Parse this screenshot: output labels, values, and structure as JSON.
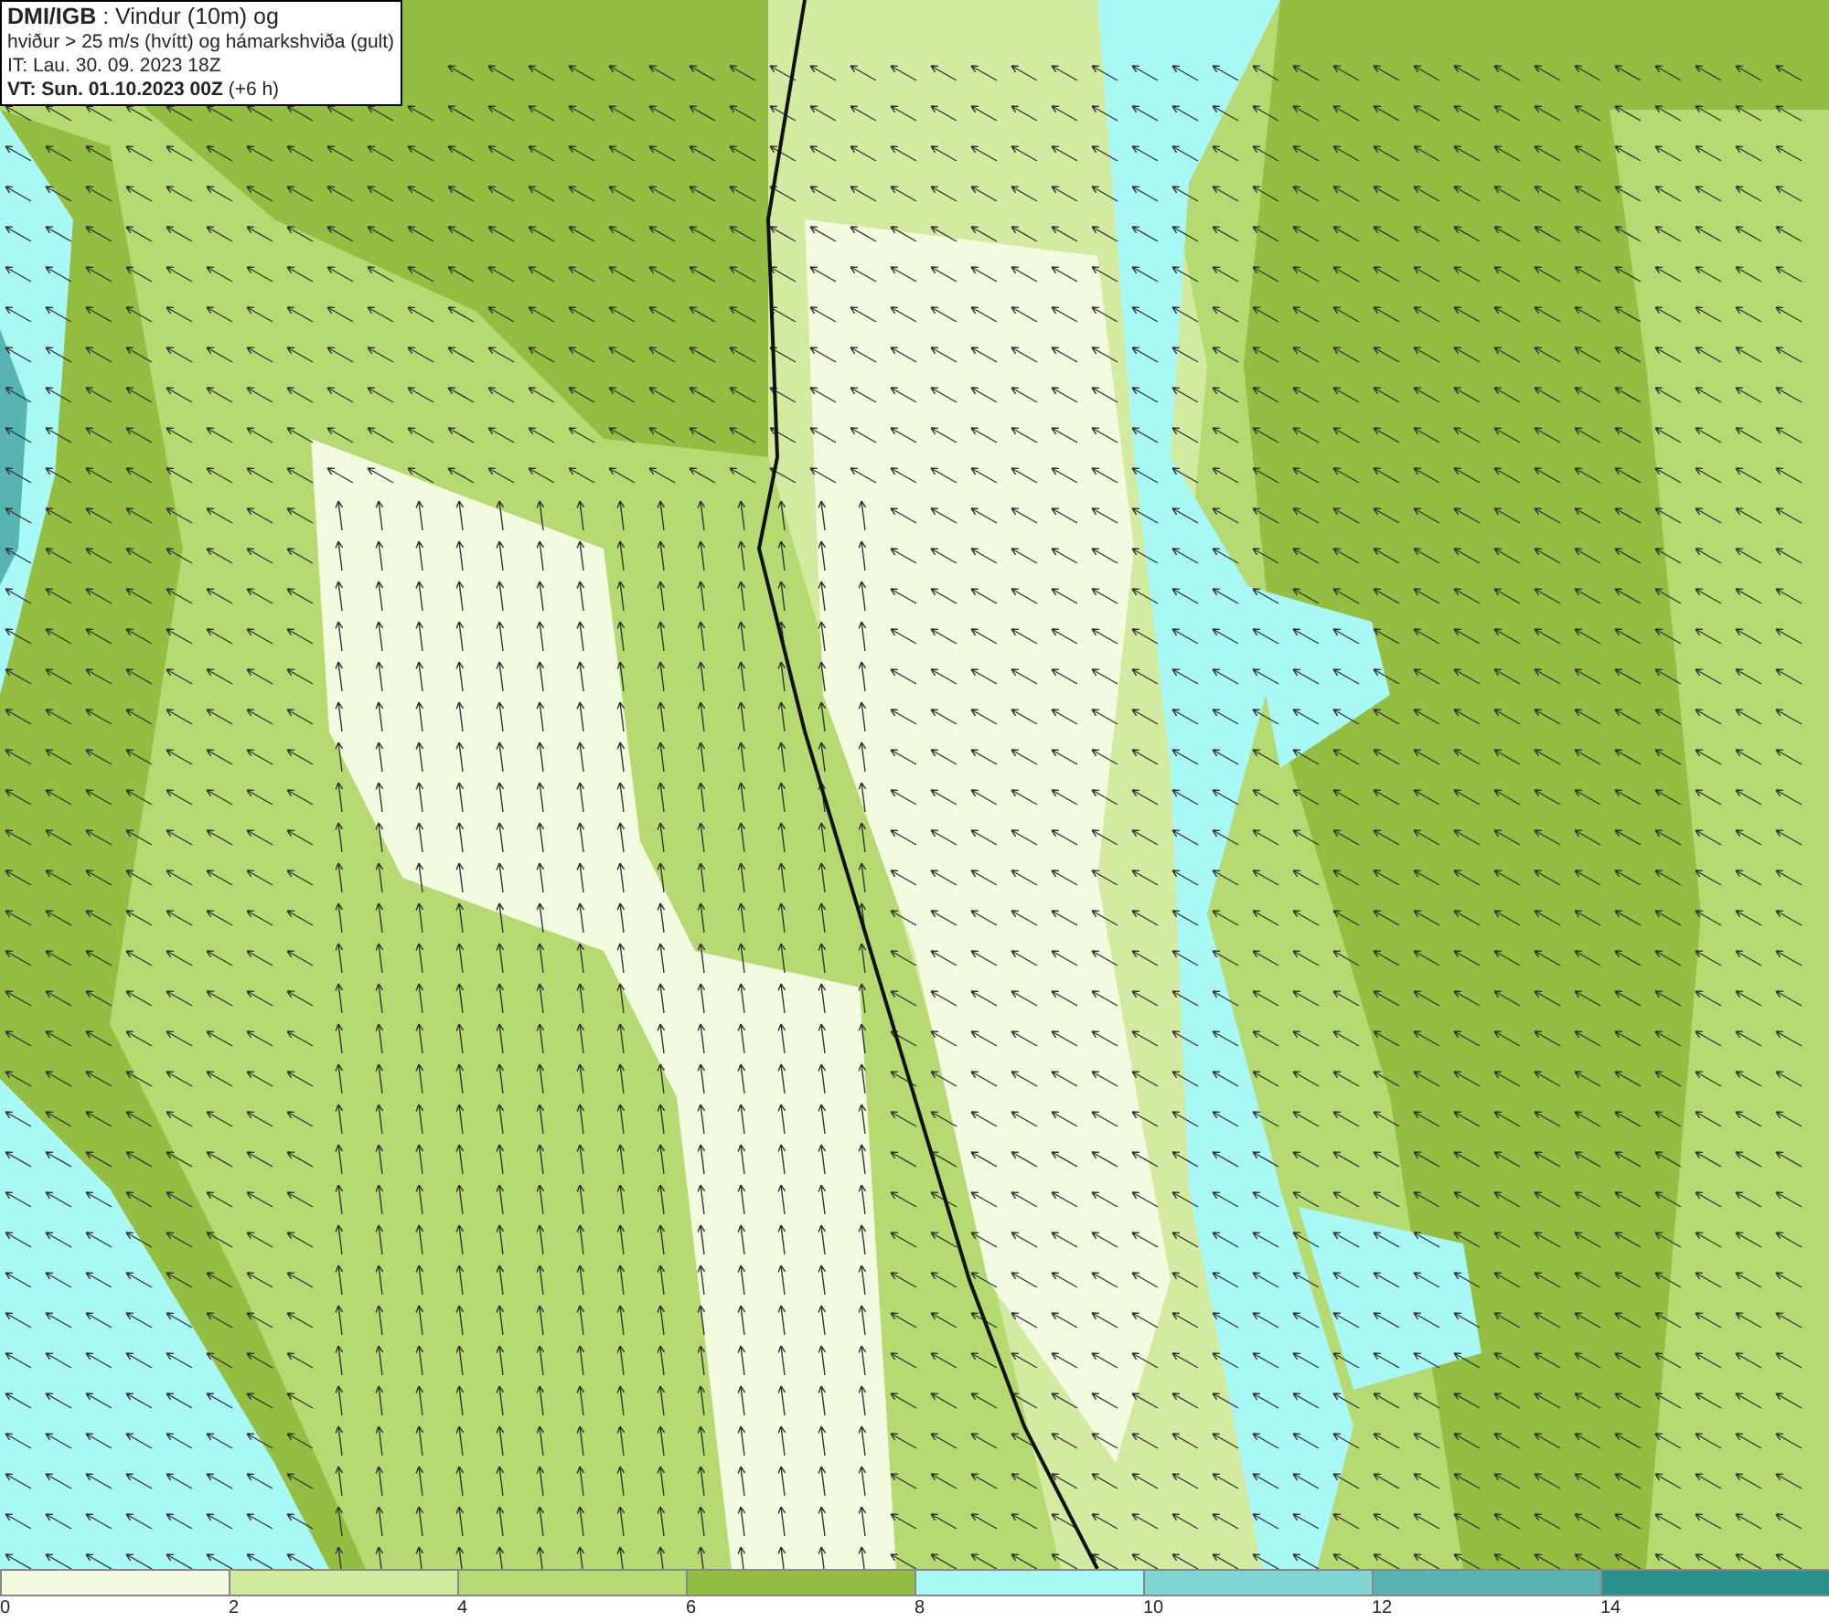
{
  "header": {
    "lines": [
      "**DMI/IGB** : Vindur (10m) og",
      "hviður > 25 m/s (hvítt) og hámarkshviða (gult)",
      "IT: Lau. 30. 09. 2023 18Z",
      "**VT: Sun. 01.10.2023 00Z** (+6 h)"
    ]
  },
  "legend": {
    "bins": [
      {
        "color": "#f2fadf"
      },
      {
        "color": "#d3eba0"
      },
      {
        "color": "#b6da72"
      },
      {
        "color": "#94be42"
      },
      {
        "color": "#a8f8f6"
      },
      {
        "color": "#80d4d3"
      },
      {
        "color": "#57b4b2"
      },
      {
        "color": "#2a918d"
      }
    ],
    "labels": [
      "0",
      "2",
      "4",
      "6",
      "8",
      "10",
      "12",
      "14"
    ]
  }
}
